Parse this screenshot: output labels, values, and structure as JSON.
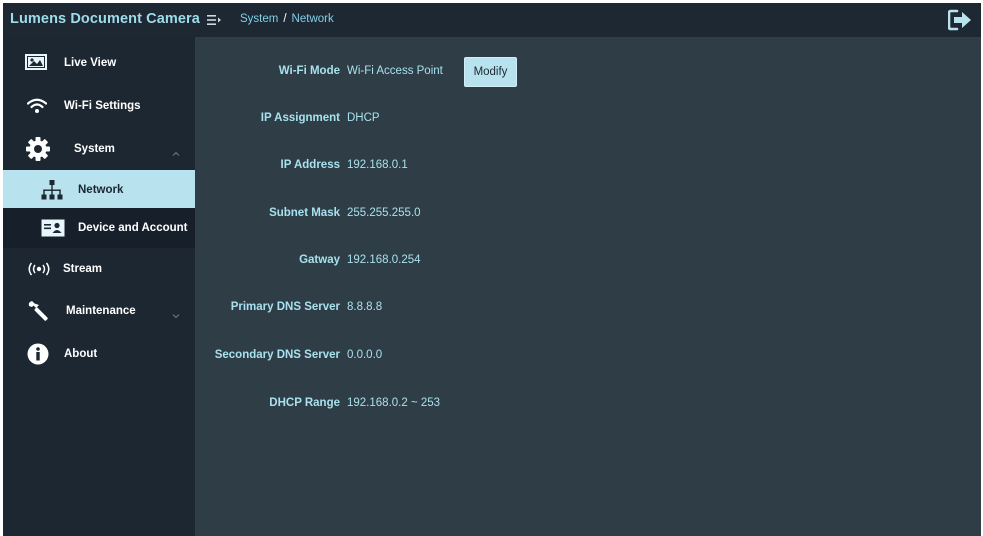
{
  "app": {
    "title": "Lumens Document Camera"
  },
  "breadcrumb": {
    "parent": "System",
    "separator": "/",
    "current": "Network"
  },
  "sidebar": {
    "items": [
      {
        "label": "Live View",
        "icon": "live-view-icon"
      },
      {
        "label": "Wi-Fi Settings",
        "icon": "wifi-icon"
      },
      {
        "label": "System",
        "icon": "gear-icon",
        "expanded": true
      },
      {
        "label": "Network",
        "icon": "network-icon",
        "active": true
      },
      {
        "label": "Device and Account",
        "icon": "id-card-icon"
      },
      {
        "label": "Stream",
        "icon": "broadcast-icon"
      },
      {
        "label": "Maintenance",
        "icon": "wrench-icon",
        "expanded": false
      },
      {
        "label": "About",
        "icon": "info-icon"
      }
    ]
  },
  "network": {
    "fields": [
      {
        "label": "Wi-Fi Mode",
        "value": "Wi-Fi Access Point"
      },
      {
        "label": "IP Assignment",
        "value": "DHCP"
      },
      {
        "label": "IP Address",
        "value": "192.168.0.1"
      },
      {
        "label": "Subnet Mask",
        "value": "255.255.255.0"
      },
      {
        "label": "Gatway",
        "value": "192.168.0.254"
      },
      {
        "label": "Primary DNS Server",
        "value": "8.8.8.8"
      },
      {
        "label": "Secondary DNS Server",
        "value": "0.0.0.0"
      },
      {
        "label": "DHCP Range",
        "value": "192.168.0.2 ~ 253"
      }
    ],
    "modify_label": "Modify"
  },
  "colors": {
    "topbar": "#1e2833",
    "sidebar": "#1d2732",
    "content": "#2f3e46",
    "accent": "#b8e3ee",
    "text_accent": "#a8e1ef"
  }
}
